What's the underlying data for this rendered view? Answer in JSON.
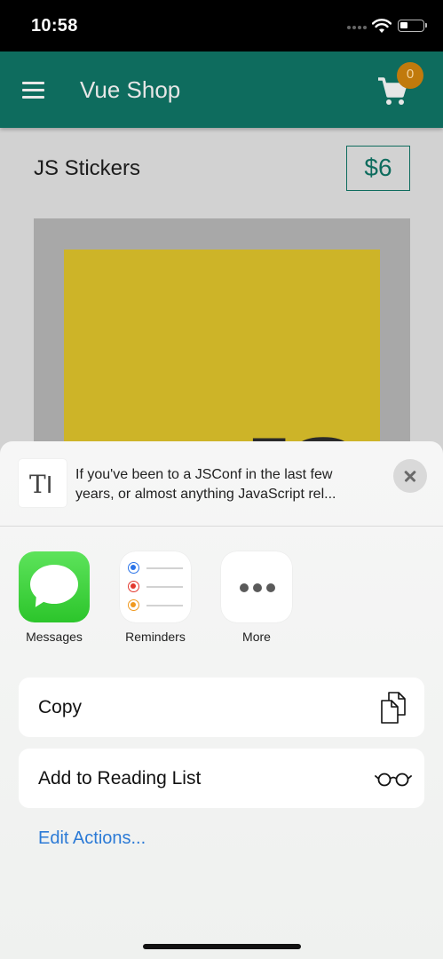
{
  "status_bar": {
    "time": "10:58"
  },
  "app_bar": {
    "title": "Vue Shop",
    "cart_count": "0"
  },
  "product": {
    "title": "JS Stickers",
    "price": "$6",
    "image_text": "JS"
  },
  "share_sheet": {
    "preview_text_line1": "If you've been to a JSConf in the last few",
    "preview_text_line2": "years, or almost anything JavaScript rel...",
    "apps": [
      {
        "label": "Messages",
        "icon": "messages-icon"
      },
      {
        "label": "Reminders",
        "icon": "reminders-icon"
      },
      {
        "label": "More",
        "icon": "more-icon"
      }
    ],
    "actions": [
      {
        "label": "Copy",
        "icon": "copy-icon"
      },
      {
        "label": "Add to Reading List",
        "icon": "glasses-icon"
      }
    ],
    "edit_actions": "Edit Actions..."
  },
  "colors": {
    "app_bar": "#0e6c5e",
    "badge": "#c17a0c",
    "link": "#2b7ad6",
    "js_yellow": "#cdb428"
  }
}
